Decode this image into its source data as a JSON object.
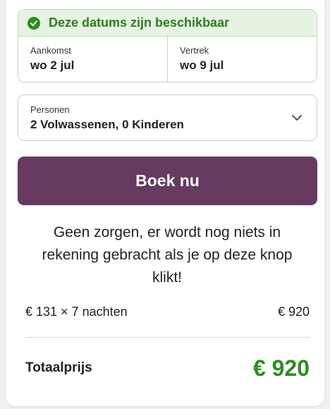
{
  "availability": {
    "message": "Deze datums zijn beschikbaar",
    "status_color": "#2e8b22",
    "icon": "check-circle-icon"
  },
  "dates": {
    "arrival": {
      "label": "Aankomst",
      "value": "wo 2 jul"
    },
    "departure": {
      "label": "Vertrek",
      "value": "wo 9 jul"
    }
  },
  "guests": {
    "label": "Personen",
    "value": "2 Volwassenen, 0 Kinderen",
    "icon": "chevron-down-icon"
  },
  "booking": {
    "button_label": "Boek nu",
    "button_color": "#663a61",
    "note": "Geen zorgen, er wordt nog niets in rekening gebracht als je op deze knop klikt!"
  },
  "pricing": {
    "breakdown_label": "€ 131 × 7 nachten",
    "breakdown_value": "€ 920",
    "total_label": "Totaalprijs",
    "total_value": "€ 920",
    "total_color": "#2e8b22"
  }
}
